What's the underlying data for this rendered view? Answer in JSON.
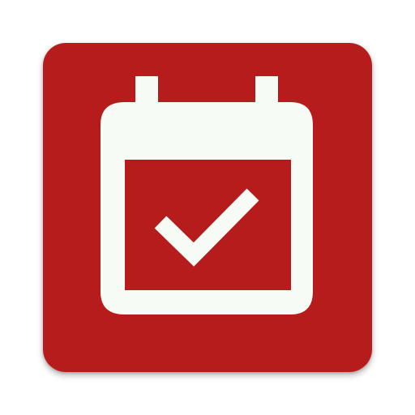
{
  "app_icon": {
    "icon": "calendar-check-icon",
    "colors": {
      "background": "#B71C1C",
      "glyph": "#F6FBF6"
    }
  }
}
